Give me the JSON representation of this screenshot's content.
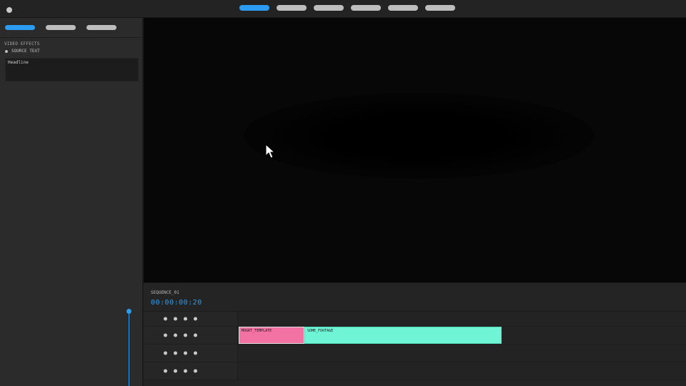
{
  "menu": {
    "tabs": [
      "",
      "",
      "",
      "",
      "",
      ""
    ],
    "active_index": 0
  },
  "sidebar": {
    "tabs": [
      "",
      "",
      ""
    ],
    "section_title": "VIDEO EFFECTS",
    "property_label": "SOURCE TEXT",
    "text_value": "Headline"
  },
  "timeline": {
    "sequence_name": "SEQUENCE_01",
    "timecode": "00:00:00:20",
    "clips": [
      {
        "name": "MOGRT_TEMPLATE",
        "color": "#f272a3"
      },
      {
        "name": "SOME_FOOTAGE",
        "color": "#6ff5d6"
      }
    ]
  },
  "colors": {
    "accent": "#2b9cf2",
    "viewer_bg": "#070707",
    "panel_bg": "#2b2b2b"
  },
  "icons": {
    "cursor": "arrow-cursor-icon",
    "window": "window-dot-icon",
    "track_controls": "dot-icon"
  }
}
